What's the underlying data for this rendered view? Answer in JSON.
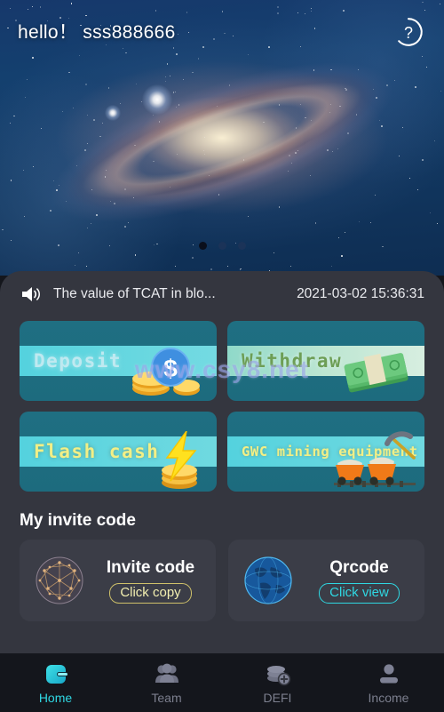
{
  "header": {
    "greeting": "hello！ sss888666",
    "help_icon": "question-circle-icon"
  },
  "banner": {
    "image_alt": "spiral-galaxy",
    "carousel": {
      "total": 3,
      "active_index": 0
    }
  },
  "notice": {
    "speaker_icon": "speaker-icon",
    "text": "The value of TCAT in blo...",
    "time": "2021-03-02 15:36:31"
  },
  "watermark": "www.csy8.net",
  "actions": [
    {
      "label": "Deposit",
      "art": "dollar-coins-icon"
    },
    {
      "label": "Withdraw",
      "art": "cash-bundle-icon"
    },
    {
      "label": "Flash cash",
      "art": "lightning-coins-icon"
    },
    {
      "label": "GWC mining equipment",
      "art": "mining-carts-icon"
    }
  ],
  "invite": {
    "title": "My invite code",
    "items": [
      {
        "name": "Invite code",
        "action": "Click copy",
        "icon": "network-sphere-icon"
      },
      {
        "name": "Qrcode",
        "action": "Click view",
        "icon": "digital-globe-icon"
      }
    ]
  },
  "nav": [
    {
      "label": "Home",
      "icon": "wallet-icon",
      "active": true
    },
    {
      "label": "Team",
      "icon": "people-icon",
      "active": false
    },
    {
      "label": "DEFI",
      "icon": "coins-plus-icon",
      "active": false
    },
    {
      "label": "Income",
      "icon": "person-icon",
      "active": false
    }
  ],
  "colors": {
    "accent": "#2fd7e2",
    "panel": "#34363f",
    "nav_bg": "#14161c",
    "card_teal": "#1d6f82",
    "band_cyan": "#54d2de",
    "pill_yellow": "#f3efb0"
  }
}
